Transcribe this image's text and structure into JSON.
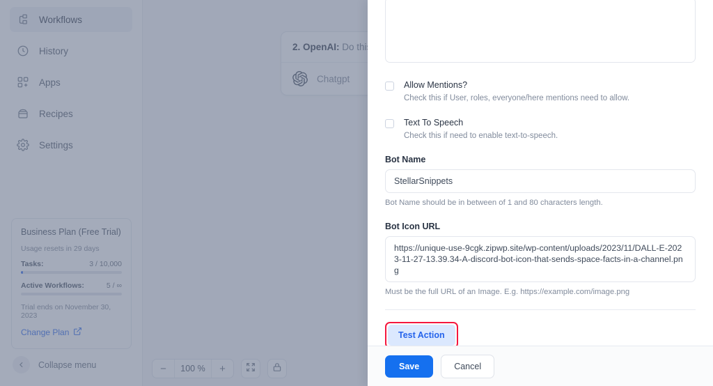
{
  "sidebar": {
    "items": [
      {
        "label": "Workflows",
        "icon": "workflows-icon",
        "active": true
      },
      {
        "label": "History",
        "icon": "history-icon",
        "active": false
      },
      {
        "label": "Apps",
        "icon": "apps-icon",
        "active": false
      },
      {
        "label": "Recipes",
        "icon": "recipes-icon",
        "active": false
      },
      {
        "label": "Settings",
        "icon": "settings-icon",
        "active": false
      }
    ],
    "plan": {
      "title": "Business Plan (Free Trial)",
      "usage_reset": "Usage resets in 29 days",
      "tasks_label": "Tasks:",
      "tasks_value": "3 / 10,000",
      "tasks_percent": 2,
      "workflows_label": "Active Workflows:",
      "workflows_value": "5 / ∞",
      "workflows_percent": 0,
      "trial_end": "Trial ends on November 30, 2023",
      "change_plan_label": "Change Plan",
      "change_plan_icon": "external-link-icon",
      "accent_color": "#2563eb"
    },
    "collapse_label": "Collapse menu",
    "collapse_icon": "chevron-left-icon"
  },
  "canvas": {
    "node": {
      "step_title": "2. OpenAI:",
      "step_subtitle": " Do this",
      "app_name": "Chatgpt",
      "app_icon": "openai-icon"
    },
    "zoom": {
      "minus_label": "−",
      "level": "100 %",
      "plus_label": "+",
      "fit_icon": "fit-screen-icon",
      "lock_icon": "lock-icon"
    }
  },
  "panel": {
    "message_textarea": {
      "value": "",
      "placeholder": ""
    },
    "checkboxes": [
      {
        "title": "Allow Mentions?",
        "help": "Check this if User, roles, everyone/here mentions need to allow.",
        "checked": false
      },
      {
        "title": "Text To Speech",
        "help": "Check this if need to enable text-to-speech.",
        "checked": false
      }
    ],
    "bot_name": {
      "label": "Bot Name",
      "value": "StellarSnippets",
      "placeholder": "Bot Name",
      "help": "Bot Name should be in between of 1 and 80 characters length."
    },
    "bot_icon_url": {
      "label": "Bot Icon URL",
      "value": "https://unique-use-9cgk.zipwp.site/wp-content/uploads/2023/11/DALL-E-2023-11-27-13.39.34-A-discord-bot-icon-that-sends-space-facts-in-a-channel.png",
      "placeholder": "Bot Icon URL",
      "help": "Must be the full URL of an Image. E.g. https://example.com/image.png"
    },
    "test_action_label": "Test Action",
    "test_action_highlight_color": "#f5173e",
    "save_label": "Save",
    "cancel_label": "Cancel"
  }
}
